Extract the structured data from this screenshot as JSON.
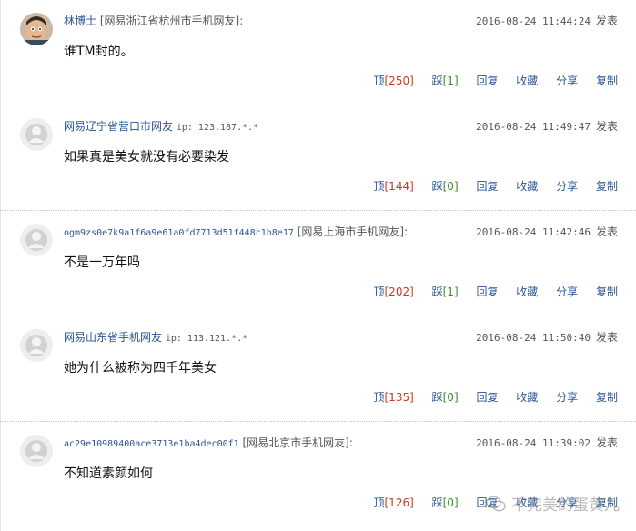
{
  "comments": [
    {
      "user": "林博士",
      "location": "[网易浙江省杭州市手机网友]:",
      "ip": "",
      "time": "2016-08-24 11:44:24",
      "publish": "发表",
      "text": "谁TM封的。",
      "up_label": "顶",
      "up_count": "[250]",
      "down_label": "踩",
      "down_count": "[1]",
      "avatar": "photo-avatar"
    },
    {
      "user": "网易辽宁省营口市网友",
      "location": "",
      "ip": "ip: 123.187.*.*",
      "time": "2016-08-24 11:49:47",
      "publish": "发表",
      "text": "如果真是美女就没有必要染发",
      "up_label": "顶",
      "up_count": "[144]",
      "down_label": "踩",
      "down_count": "[0]",
      "avatar": "default-avatar"
    },
    {
      "user": "ogm9zs0e7k9a1f6a9e61a0fd7713d51f448c1b8e17",
      "location": "[网易上海市手机网友]:",
      "ip": "",
      "time": "2016-08-24 11:42:46",
      "publish": "发表",
      "text": "不是一万年吗",
      "up_label": "顶",
      "up_count": "[202]",
      "down_label": "踩",
      "down_count": "[1]",
      "avatar": "default-avatar"
    },
    {
      "user": "网易山东省手机网友",
      "location": "",
      "ip": "ip: 113.121.*.*",
      "time": "2016-08-24 11:50:40",
      "publish": "发表",
      "text": "她为什么被称为四千年美女",
      "up_label": "顶",
      "up_count": "[135]",
      "down_label": "踩",
      "down_count": "[0]",
      "avatar": "default-avatar"
    },
    {
      "user": "ac29e10989400ace3713e1ba4dec00f1",
      "location": "[网易北京市手机网友]:",
      "ip": "",
      "time": "2016-08-24 11:39:02",
      "publish": "发表",
      "text": "不知道素颜如何",
      "up_label": "顶",
      "up_count": "[126]",
      "down_label": "踩",
      "down_count": "[0]",
      "avatar": "default-avatar"
    }
  ],
  "actions": {
    "reply": "回复",
    "favorite": "收藏",
    "share": "分享",
    "copy": "复制"
  },
  "watermark": "不完美的蛋黄儿",
  "colors": {
    "link": "#2a5595",
    "up_count": "#c63b1e",
    "down_count": "#3d8a2b",
    "divider": "#c8c8c8"
  }
}
